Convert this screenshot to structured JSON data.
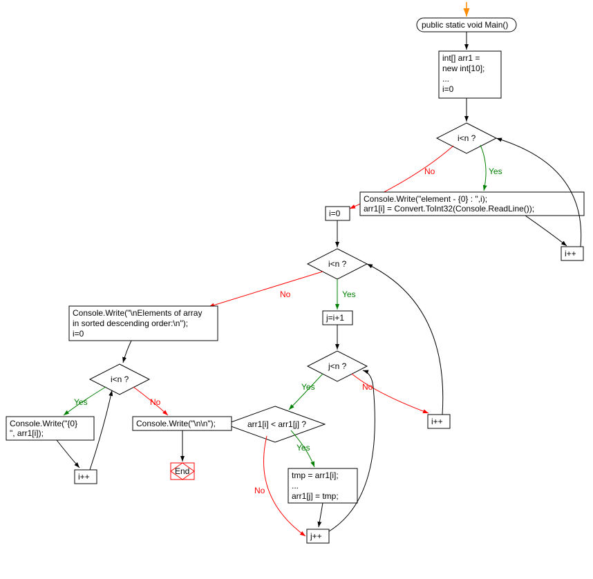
{
  "nodes": {
    "start": "public static void Main()",
    "init": {
      "line1": "int[] arr1 =",
      "line2": "new int[10];",
      "line3": "...",
      "line4": "i=0"
    },
    "cond1": "i<n ?",
    "read": {
      "line1": "Console.Write(\"element - {0} : \",i);",
      "line2": "arr1[i] = Convert.ToInt32(Console.ReadLine());"
    },
    "inc1": "i++",
    "reset1": "i=0",
    "cond2": "i<n ?",
    "jinit": "j=i+1",
    "cond3": "j<n ?",
    "cond4": "arr1[i] < arr1[j] ?",
    "swap": {
      "line1": "tmp = arr1[i];",
      "line2": "...",
      "line3": "arr1[j] = tmp;"
    },
    "jinc": "j++",
    "inc2": "i++",
    "printhdr": {
      "line1": "Console.Write(\"\\nElements of array",
      "line2": "in sorted descending order:\\n\");",
      "line3": "i=0"
    },
    "cond5": "i<n ?",
    "printel": {
      "line1": "Console.Write(\"{0}",
      "line2": "\", arr1[i]);"
    },
    "inc3": "i++",
    "printnl": "Console.Write(\"\\n\\n\");",
    "end": "End"
  },
  "labels": {
    "yes": "Yes",
    "no": "No"
  }
}
